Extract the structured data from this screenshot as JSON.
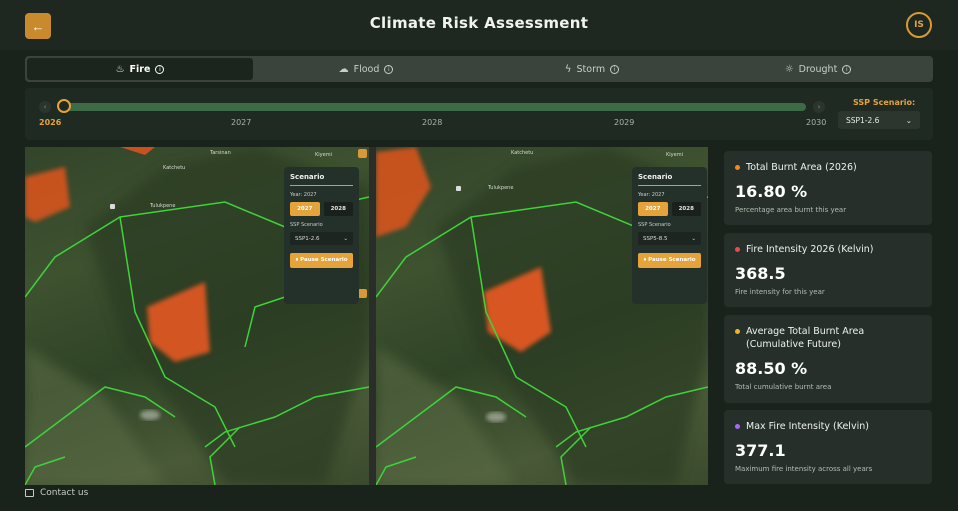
{
  "header": {
    "title": "Climate Risk Assessment",
    "avatar_initials": "IS",
    "back_icon": "arrow-left-icon"
  },
  "tabs": [
    {
      "label": "Fire",
      "icon": "flame-icon",
      "glyph": "•",
      "active": true
    },
    {
      "label": "Flood",
      "icon": "cloud-rain-icon",
      "glyph": "☁",
      "active": false
    },
    {
      "label": "Storm",
      "icon": "lightning-icon",
      "glyph": "ϟ",
      "active": false
    },
    {
      "label": "Drought",
      "icon": "sun-icon",
      "glyph": "☼",
      "active": false
    }
  ],
  "timeline": {
    "years": [
      "2026",
      "2027",
      "2028",
      "2029",
      "2030"
    ],
    "current": "2026",
    "ssp_label": "SSP Scenario:",
    "ssp_value": "SSP1-2.6"
  },
  "map_left": {
    "labels": [
      "Katchetu",
      "Tulukpene",
      "Tarsinan",
      "Kiyemi"
    ],
    "scenario": {
      "title": "Scenario",
      "year_label": "Year: 2027",
      "year_a": "2027",
      "year_b": "2028",
      "ssp_label": "SSP Scenario",
      "ssp_value": "SSP1-2.6",
      "pause_label": "⏸ Pause Scenario"
    }
  },
  "map_right": {
    "labels": [
      "Katchetu",
      "Tulukpene",
      "Kiyemi"
    ],
    "scenario": {
      "title": "Scenario",
      "year_label": "Year: 2027",
      "year_a": "2027",
      "year_b": "2028",
      "ssp_label": "SSP Scenario",
      "ssp_value": "SSP5-8.5",
      "pause_label": "⏸ Pause Scenario"
    }
  },
  "stats": [
    {
      "title": "Total Burnt Area (2026)",
      "value": "16.80 %",
      "desc": "Percentage area burnt this year",
      "color": "#f08a24"
    },
    {
      "title": "Fire Intensity 2026 (Kelvin)",
      "value": "368.5",
      "desc": "Fire intensity for this year",
      "color": "#e84b4b"
    },
    {
      "title": "Average Total Burnt Area (Cumulative Future)",
      "value": "88.50 %",
      "desc": "Total cumulative burnt area",
      "color": "#f0b429"
    },
    {
      "title": "Max Fire Intensity (Kelvin)",
      "value": "377.1",
      "desc": "Maximum fire intensity across all years",
      "color": "#a36cf0"
    }
  ],
  "footer": {
    "contact": "Contact us"
  }
}
